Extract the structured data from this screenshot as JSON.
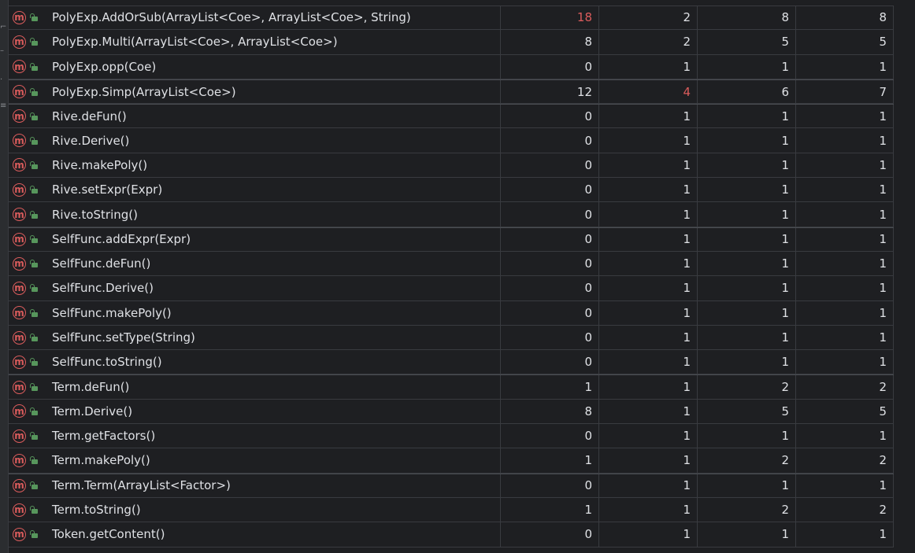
{
  "colors": {
    "background": "#1e1f22",
    "text": "#dfe1e5",
    "highlight": "#db5c5c",
    "method_icon": "#db5c5c",
    "public_icon": "#57965c",
    "grid": "#393b40"
  },
  "icons": {
    "method": "method-icon",
    "method_letter": "m",
    "visibility": "public-lock-icon"
  },
  "rows": [
    {
      "name": "PolyExp.AddOrSub(ArrayList<Coe>, ArrayList<Coe>, String)",
      "c1": "18",
      "c2": "2",
      "c3": "8",
      "c4": "8",
      "hot": [
        true,
        false,
        false,
        false
      ]
    },
    {
      "name": "PolyExp.Multi(ArrayList<Coe>, ArrayList<Coe>)",
      "c1": "8",
      "c2": "2",
      "c3": "5",
      "c4": "5",
      "hot": [
        false,
        false,
        false,
        false
      ]
    },
    {
      "name": "PolyExp.opp(Coe)",
      "c1": "0",
      "c2": "1",
      "c3": "1",
      "c4": "1",
      "hot": [
        false,
        false,
        false,
        false
      ]
    },
    {
      "name": "PolyExp.Simp(ArrayList<Coe>)",
      "c1": "12",
      "c2": "4",
      "c3": "6",
      "c4": "7",
      "hot": [
        false,
        true,
        false,
        false
      ]
    },
    {
      "name": "Rive.deFun()",
      "c1": "0",
      "c2": "1",
      "c3": "1",
      "c4": "1",
      "hot": [
        false,
        false,
        false,
        false
      ]
    },
    {
      "name": "Rive.Derive()",
      "c1": "0",
      "c2": "1",
      "c3": "1",
      "c4": "1",
      "hot": [
        false,
        false,
        false,
        false
      ]
    },
    {
      "name": "Rive.makePoly()",
      "c1": "0",
      "c2": "1",
      "c3": "1",
      "c4": "1",
      "hot": [
        false,
        false,
        false,
        false
      ]
    },
    {
      "name": "Rive.setExpr(Expr)",
      "c1": "0",
      "c2": "1",
      "c3": "1",
      "c4": "1",
      "hot": [
        false,
        false,
        false,
        false
      ]
    },
    {
      "name": "Rive.toString()",
      "c1": "0",
      "c2": "1",
      "c3": "1",
      "c4": "1",
      "hot": [
        false,
        false,
        false,
        false
      ]
    },
    {
      "name": "SelfFunc.addExpr(Expr)",
      "c1": "0",
      "c2": "1",
      "c3": "1",
      "c4": "1",
      "hot": [
        false,
        false,
        false,
        false
      ]
    },
    {
      "name": "SelfFunc.deFun()",
      "c1": "0",
      "c2": "1",
      "c3": "1",
      "c4": "1",
      "hot": [
        false,
        false,
        false,
        false
      ]
    },
    {
      "name": "SelfFunc.Derive()",
      "c1": "0",
      "c2": "1",
      "c3": "1",
      "c4": "1",
      "hot": [
        false,
        false,
        false,
        false
      ]
    },
    {
      "name": "SelfFunc.makePoly()",
      "c1": "0",
      "c2": "1",
      "c3": "1",
      "c4": "1",
      "hot": [
        false,
        false,
        false,
        false
      ]
    },
    {
      "name": "SelfFunc.setType(String)",
      "c1": "0",
      "c2": "1",
      "c3": "1",
      "c4": "1",
      "hot": [
        false,
        false,
        false,
        false
      ]
    },
    {
      "name": "SelfFunc.toString()",
      "c1": "0",
      "c2": "1",
      "c3": "1",
      "c4": "1",
      "hot": [
        false,
        false,
        false,
        false
      ]
    },
    {
      "name": "Term.deFun()",
      "c1": "1",
      "c2": "1",
      "c3": "2",
      "c4": "2",
      "hot": [
        false,
        false,
        false,
        false
      ]
    },
    {
      "name": "Term.Derive()",
      "c1": "8",
      "c2": "1",
      "c3": "5",
      "c4": "5",
      "hot": [
        false,
        false,
        false,
        false
      ]
    },
    {
      "name": "Term.getFactors()",
      "c1": "0",
      "c2": "1",
      "c3": "1",
      "c4": "1",
      "hot": [
        false,
        false,
        false,
        false
      ]
    },
    {
      "name": "Term.makePoly()",
      "c1": "1",
      "c2": "1",
      "c3": "2",
      "c4": "2",
      "hot": [
        false,
        false,
        false,
        false
      ]
    },
    {
      "name": "Term.Term(ArrayList<Factor>)",
      "c1": "0",
      "c2": "1",
      "c3": "1",
      "c4": "1",
      "hot": [
        false,
        false,
        false,
        false
      ]
    },
    {
      "name": "Term.toString()",
      "c1": "1",
      "c2": "1",
      "c3": "2",
      "c4": "2",
      "hot": [
        false,
        false,
        false,
        false
      ]
    },
    {
      "name": "Token.getContent()",
      "c1": "0",
      "c2": "1",
      "c3": "1",
      "c4": "1",
      "hot": [
        false,
        false,
        false,
        false
      ]
    }
  ]
}
